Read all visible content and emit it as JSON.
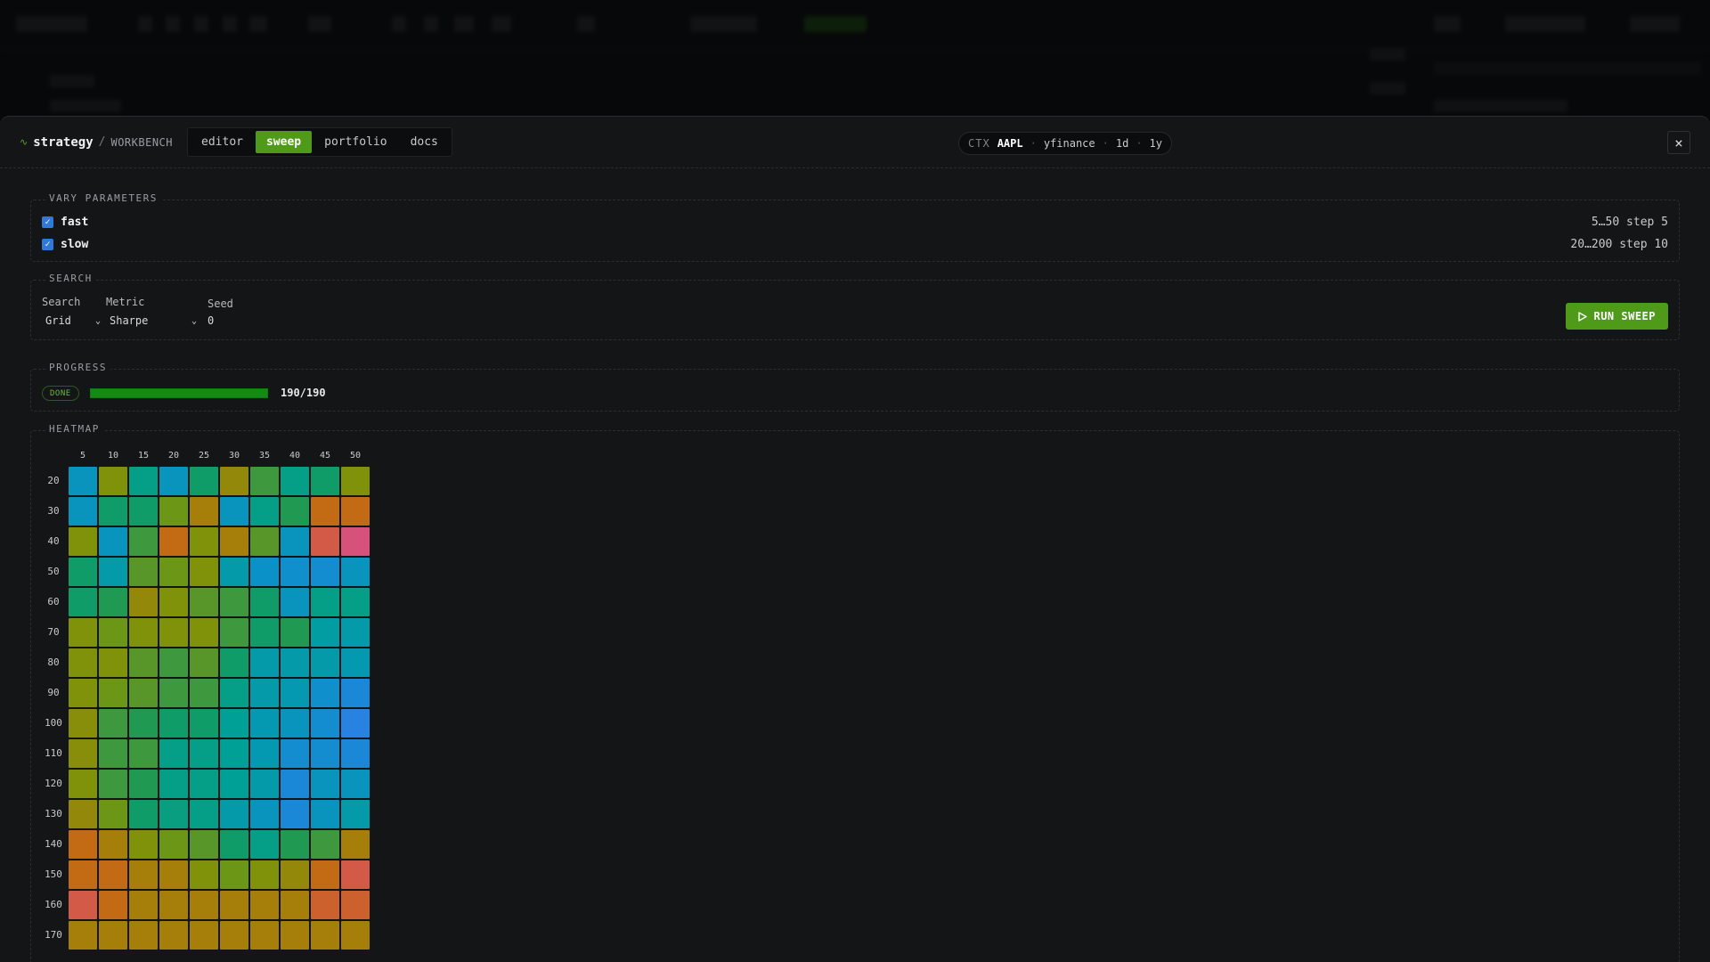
{
  "colors": {
    "accent": "#4f9a18",
    "checkbox": "#2f7ad9",
    "progress": "#138b13",
    "heat_low": "#d55858",
    "heat_high": "#1a8ae0"
  },
  "header": {
    "logo_icon": "trend-icon",
    "app_name": "strategy",
    "separator": "/",
    "subtitle": "WORKBENCH",
    "tabs": [
      {
        "label": "editor",
        "active": false
      },
      {
        "label": "sweep",
        "active": true
      },
      {
        "label": "portfolio",
        "active": false
      },
      {
        "label": "docs",
        "active": false
      }
    ],
    "context": {
      "label": "CTX",
      "symbol": "AAPL",
      "source": "yfinance",
      "interval": "1d",
      "period": "1y"
    },
    "close_icon": "close-icon"
  },
  "vary": {
    "title": "VARY PARAMETERS",
    "params": [
      {
        "name": "fast",
        "checked": true,
        "range": "5…50 step 5"
      },
      {
        "name": "slow",
        "checked": true,
        "range": "20…200 step 10"
      }
    ]
  },
  "search": {
    "title": "SEARCH",
    "search_label": "Search",
    "search_value": "Grid",
    "metric_label": "Metric",
    "metric_value": "Sharpe",
    "seed_label": "Seed",
    "seed_value": "0",
    "run_label": "RUN SWEEP",
    "run_icon": "play-icon"
  },
  "progress": {
    "title": "PROGRESS",
    "status": "DONE",
    "done": 190,
    "total": 190,
    "text": "190/190"
  },
  "heatmap": {
    "title": "HEATMAP"
  },
  "chart_data": {
    "type": "heatmap",
    "title": "",
    "xlabel": "",
    "ylabel": "",
    "x": [
      5,
      10,
      15,
      20,
      25,
      30,
      35,
      40,
      45,
      50
    ],
    "y": [
      20,
      30,
      40,
      50,
      60,
      70,
      80,
      90,
      100,
      110,
      120,
      130,
      140,
      150,
      160,
      170
    ],
    "values": [
      [
        0.85,
        0.4,
        0.72,
        0.85,
        0.65,
        0.35,
        0.55,
        0.72,
        0.65,
        0.4
      ],
      [
        0.85,
        0.65,
        0.65,
        0.45,
        0.3,
        0.85,
        0.72,
        0.6,
        0.2,
        0.2
      ],
      [
        0.4,
        0.85,
        0.55,
        0.2,
        0.4,
        0.3,
        0.5,
        0.85,
        0.1,
        0.0
      ],
      [
        0.65,
        0.8,
        0.5,
        0.45,
        0.4,
        0.8,
        0.88,
        0.9,
        0.92,
        0.85
      ],
      [
        0.65,
        0.6,
        0.35,
        0.4,
        0.5,
        0.55,
        0.65,
        0.85,
        0.72,
        0.72
      ],
      [
        0.4,
        0.45,
        0.4,
        0.4,
        0.4,
        0.55,
        0.65,
        0.6,
        0.78,
        0.8
      ],
      [
        0.4,
        0.4,
        0.5,
        0.55,
        0.5,
        0.65,
        0.8,
        0.8,
        0.8,
        0.82
      ],
      [
        0.4,
        0.45,
        0.5,
        0.55,
        0.55,
        0.72,
        0.8,
        0.82,
        0.9,
        0.95
      ],
      [
        0.38,
        0.55,
        0.6,
        0.65,
        0.65,
        0.75,
        0.82,
        0.85,
        0.92,
        1.0
      ],
      [
        0.38,
        0.55,
        0.55,
        0.72,
        0.72,
        0.75,
        0.82,
        0.92,
        0.92,
        0.95
      ],
      [
        0.4,
        0.55,
        0.6,
        0.72,
        0.72,
        0.75,
        0.8,
        0.95,
        0.85,
        0.85
      ],
      [
        0.35,
        0.45,
        0.65,
        0.7,
        0.72,
        0.8,
        0.85,
        0.95,
        0.85,
        0.8
      ],
      [
        0.2,
        0.3,
        0.4,
        0.45,
        0.5,
        0.65,
        0.72,
        0.6,
        0.55,
        0.3
      ],
      [
        0.2,
        0.2,
        0.3,
        0.3,
        0.4,
        0.45,
        0.4,
        0.35,
        0.2,
        0.1
      ],
      [
        0.1,
        0.2,
        0.3,
        0.3,
        0.3,
        0.3,
        0.3,
        0.3,
        0.15,
        0.15
      ],
      [
        0.3,
        0.3,
        0.3,
        0.3,
        0.3,
        0.3,
        0.3,
        0.3,
        0.3,
        0.3
      ]
    ]
  }
}
